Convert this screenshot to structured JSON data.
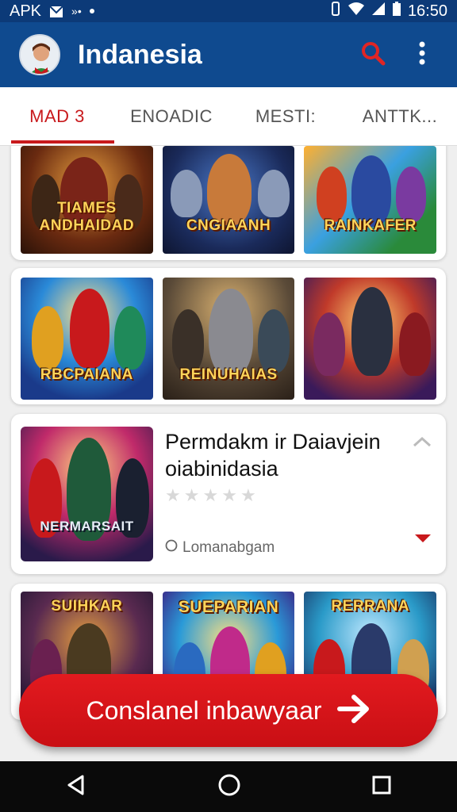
{
  "status_bar": {
    "label": "APK",
    "time": "16:50"
  },
  "app_bar": {
    "title": "Indanesia"
  },
  "tabs": [
    {
      "label": "MAD 3"
    },
    {
      "label": "ENOADIC"
    },
    {
      "label": "MESTI:"
    },
    {
      "label": "ANTTK..."
    }
  ],
  "row1": [
    {
      "title": "TIAMES ANDHAIDAD"
    },
    {
      "title": "CNGIAANH"
    },
    {
      "title": "RAINKAFER"
    }
  ],
  "row2": [
    {
      "title": "RBCPAIANA"
    },
    {
      "title": "REINUHAIAS"
    },
    {
      "title": ""
    }
  ],
  "detail": {
    "art_title": "NERMARSAIT",
    "title": "Permdakm ir Daiavjein oiabinidasia",
    "meta": "Lomanabgam",
    "rating": 0
  },
  "row3": [
    {
      "title": "SUIHKAR"
    },
    {
      "title": "SUEPARIAN"
    },
    {
      "title": "RERRANA"
    }
  ],
  "cta": {
    "label": "Conslanel inbawyaar"
  },
  "colors": {
    "primary": "#0f4a8f",
    "accent": "#c8191c",
    "cta": "#e21a1f"
  }
}
